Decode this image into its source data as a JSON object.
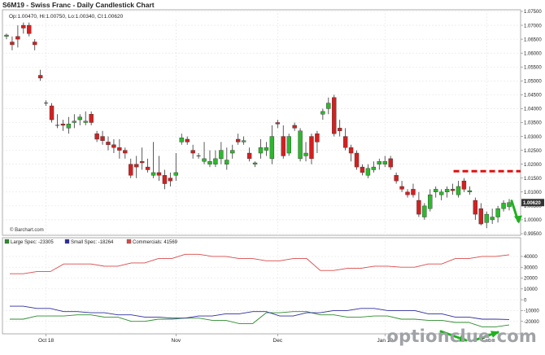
{
  "header": {
    "title": "S6M19 - Swiss Franc - Daily Candlestick Chart",
    "ohlc": "Op:1.00470, Hi:1.00750, Lo:1.00340, Cl:1.00620"
  },
  "credit": "© Barchart.com",
  "watermark": "optionclue.com",
  "colors": {
    "up": "#2db82d",
    "down": "#d42020",
    "large_spec": "#2e8b2e",
    "small_spec": "#2e2e9e",
    "commercials": "#d94a4a",
    "annotation_line": "#e01010",
    "annotation_arrow": "#22b022",
    "last_price_bg": "#333333"
  },
  "chart_data": [
    {
      "type": "candlestick",
      "title": "S6M19 - Swiss Franc - Daily Candlestick Chart",
      "ylim": [
        0.995,
        1.075
      ],
      "y_ticks": [
        "1.07500",
        "1.07000",
        "1.06500",
        "1.06000",
        "1.05500",
        "1.05000",
        "1.04500",
        "1.04000",
        "1.03500",
        "1.03000",
        "1.02500",
        "1.02000",
        "1.01500",
        "1.01000",
        "1.00500",
        "1.00000",
        "0.99500"
      ],
      "x_ticks": [
        "Oct 18",
        "Nov",
        "Dec",
        "Jan 19",
        "Feb"
      ],
      "last_price": "1.00620",
      "resistance_level": 1.0175,
      "candles": [
        [
          1.066,
          1.067,
          1.065,
          1.0665
        ],
        [
          1.064,
          1.066,
          1.061,
          1.063
        ],
        [
          1.066,
          1.07,
          1.062,
          1.065
        ],
        [
          1.07,
          1.071,
          1.067,
          1.069
        ],
        [
          1.07,
          1.071,
          1.066,
          1.067
        ],
        [
          1.064,
          1.065,
          1.061,
          1.063
        ],
        [
          1.052,
          1.054,
          1.05,
          1.051
        ],
        [
          1.042,
          1.043,
          1.041,
          1.042
        ],
        [
          1.041,
          1.042,
          1.035,
          1.036
        ],
        [
          1.034,
          1.038,
          1.033,
          1.034
        ],
        [
          1.0345,
          1.036,
          1.032,
          1.034
        ],
        [
          1.033,
          1.037,
          1.031,
          1.0345
        ],
        [
          1.035,
          1.038,
          1.033,
          1.0355
        ],
        [
          1.036,
          1.038,
          1.034,
          1.037
        ],
        [
          1.035,
          1.039,
          1.034,
          1.0355
        ],
        [
          1.038,
          1.039,
          1.034,
          1.035
        ],
        [
          1.031,
          1.032,
          1.028,
          1.029
        ],
        [
          1.03,
          1.032,
          1.027,
          1.0285
        ],
        [
          1.028,
          1.03,
          1.025,
          1.027
        ],
        [
          1.027,
          1.029,
          1.024,
          1.026
        ],
        [
          1.026,
          1.029,
          1.022,
          1.025
        ],
        [
          1.025,
          1.026,
          1.022,
          1.024
        ],
        [
          1.02,
          1.022,
          1.015,
          1.016
        ],
        [
          1.02,
          1.023,
          1.015,
          1.019
        ],
        [
          1.021,
          1.026,
          1.018,
          1.0205
        ],
        [
          1.019,
          1.022,
          1.017,
          1.018
        ],
        [
          1.016,
          1.028,
          1.015,
          1.017
        ],
        [
          1.017,
          1.023,
          1.014,
          1.016
        ],
        [
          1.016,
          1.018,
          1.011,
          1.013
        ],
        [
          1.015,
          1.017,
          1.012,
          1.014
        ],
        [
          1.016,
          1.024,
          1.014,
          1.017
        ],
        [
          1.028,
          1.031,
          1.027,
          1.0295
        ],
        [
          1.029,
          1.03,
          1.027,
          1.028
        ],
        [
          1.025,
          1.027,
          1.022,
          1.024
        ],
        [
          1.023,
          1.024,
          1.022,
          1.023
        ],
        [
          1.021,
          1.028,
          1.02,
          1.022
        ],
        [
          1.02,
          1.025,
          1.019,
          1.021
        ],
        [
          1.02,
          1.025,
          1.019,
          1.022
        ],
        [
          1.022,
          1.028,
          1.02,
          1.025
        ],
        [
          1.02,
          1.026,
          1.018,
          1.0215
        ],
        [
          1.024,
          1.027,
          1.022,
          1.025
        ],
        [
          1.029,
          1.031,
          1.027,
          1.028
        ],
        [
          1.028,
          1.03,
          1.027,
          1.0285
        ],
        [
          1.024,
          1.026,
          1.021,
          1.022
        ],
        [
          1.02,
          1.021,
          1.019,
          1.0205
        ],
        [
          1.024,
          1.029,
          1.022,
          1.026
        ],
        [
          1.025,
          1.028,
          1.023,
          1.026
        ],
        [
          1.022,
          1.034,
          1.02,
          1.03
        ],
        [
          1.035,
          1.036,
          1.033,
          1.0345
        ],
        [
          1.03,
          1.034,
          1.022,
          1.023
        ],
        [
          1.024,
          1.031,
          1.023,
          1.03
        ],
        [
          1.034,
          1.035,
          1.032,
          1.033
        ],
        [
          1.022,
          1.033,
          1.021,
          1.032
        ],
        [
          1.023,
          1.028,
          1.021,
          1.024
        ],
        [
          1.03,
          1.031,
          1.02,
          1.022
        ],
        [
          1.031,
          1.032,
          1.024,
          1.028
        ],
        [
          1.038,
          1.04,
          1.036,
          1.039
        ],
        [
          1.04,
          1.044,
          1.038,
          1.042
        ],
        [
          1.044,
          1.045,
          1.03,
          1.031
        ],
        [
          1.033,
          1.036,
          1.03,
          1.032
        ],
        [
          1.03,
          1.033,
          1.025,
          1.026
        ],
        [
          1.026,
          1.027,
          1.021,
          1.024
        ],
        [
          1.024,
          1.025,
          1.018,
          1.019
        ],
        [
          1.019,
          1.02,
          1.016,
          1.017
        ],
        [
          1.016,
          1.02,
          1.015,
          1.0185
        ],
        [
          1.018,
          1.021,
          1.017,
          1.019
        ],
        [
          1.02,
          1.022,
          1.018,
          1.021
        ],
        [
          1.02,
          1.023,
          1.019,
          1.021
        ],
        [
          1.022,
          1.023,
          1.018,
          1.019
        ],
        [
          1.016,
          1.017,
          1.013,
          1.014
        ],
        [
          1.012,
          1.014,
          1.01,
          1.011
        ],
        [
          1.01,
          1.011,
          1.008,
          1.009
        ],
        [
          1.011,
          1.013,
          1.008,
          1.009
        ],
        [
          1.007,
          1.01,
          1.001,
          1.002
        ],
        [
          1.001,
          1.006,
          1.0,
          1.005
        ],
        [
          1.004,
          1.011,
          1.003,
          1.009
        ],
        [
          1.01,
          1.012,
          1.008,
          1.011
        ],
        [
          1.009,
          1.011,
          1.007,
          1.01
        ],
        [
          1.01,
          1.012,
          1.008,
          1.011
        ],
        [
          1.011,
          1.013,
          1.009,
          1.0105
        ],
        [
          1.009,
          1.014,
          1.008,
          1.012
        ],
        [
          1.014,
          1.015,
          1.01,
          1.011
        ],
        [
          1.01,
          1.012,
          1.009,
          1.0105
        ],
        [
          1.007,
          1.008,
          1.0,
          1.002
        ],
        [
          1.004,
          1.006,
          0.998,
          0.9985
        ],
        [
          0.999,
          1.003,
          0.997,
          1.002
        ],
        [
          1.0,
          1.004,
          0.9985,
          1.001
        ],
        [
          1.001,
          1.005,
          0.999,
          1.004
        ],
        [
          1.004,
          1.007,
          1.003,
          1.006
        ],
        [
          1.0047,
          1.0075,
          1.0034,
          1.0062
        ]
      ]
    },
    {
      "type": "line",
      "ylim": [
        -30000,
        55000
      ],
      "y_ticks": [
        "40000",
        "30000",
        "20000",
        "10000",
        "0",
        "-10000",
        "-20000"
      ],
      "x_ticks": [
        "Oct 18",
        "Nov",
        "Dec",
        "Jan 19",
        "Feb"
      ],
      "series": [
        {
          "name": "Large Spec",
          "label": "Large Spec: -23305",
          "color": "#2e8b2e",
          "values": [
            -18000,
            -18000,
            -15000,
            -15000,
            -15000,
            -14000,
            -14000,
            -16000,
            -16000,
            -20000,
            -20000,
            -18000,
            -18000,
            -17000,
            -17000,
            -19000,
            -19000,
            -22000,
            -22000,
            -12000,
            -12000,
            -11000,
            -11000,
            -14000,
            -14000,
            -16000,
            -16000,
            -15000,
            -15000,
            -18000,
            -18000,
            -19000,
            -19000,
            -21000,
            -21000,
            -25000,
            -25000,
            -23305
          ]
        },
        {
          "name": "Small Spec",
          "label": "Small Spec: -18264",
          "color": "#2e2e9e",
          "values": [
            -6000,
            -6000,
            -8000,
            -8000,
            -11000,
            -11000,
            -12000,
            -12000,
            -14000,
            -14000,
            -16000,
            -16000,
            -17000,
            -17000,
            -15000,
            -15000,
            -13000,
            -13000,
            -11000,
            -11000,
            -15000,
            -15000,
            -12000,
            -12000,
            -10000,
            -10000,
            -8000,
            -8000,
            -10000,
            -10000,
            -10000,
            -13000,
            -13000,
            -16000,
            -16000,
            -18000,
            -18000,
            -18264
          ]
        },
        {
          "name": "Commercials",
          "label": "Commercials: 41569",
          "color": "#d94a4a",
          "values": [
            24000,
            24000,
            26000,
            26000,
            33000,
            33000,
            33000,
            31000,
            31000,
            34000,
            34000,
            38000,
            38000,
            42000,
            42000,
            40000,
            40000,
            38000,
            38000,
            36000,
            36000,
            38000,
            38000,
            27000,
            27000,
            29000,
            29000,
            31000,
            31000,
            30000,
            30000,
            33000,
            33000,
            38000,
            38000,
            40000,
            40000,
            41569
          ]
        }
      ]
    }
  ]
}
